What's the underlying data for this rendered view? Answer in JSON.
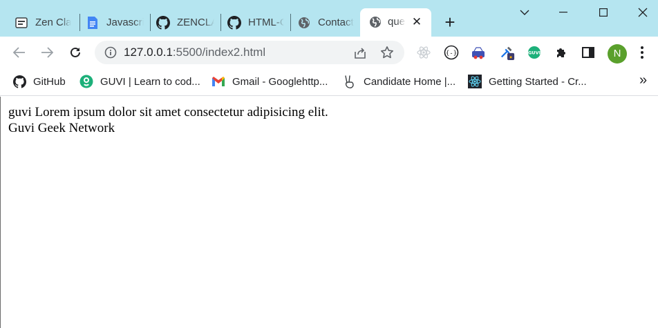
{
  "tabs": [
    {
      "title": "Zen Class",
      "icon": "zen-class-icon"
    },
    {
      "title": "Javascript",
      "icon": "google-docs-icon"
    },
    {
      "title": "ZENCLASS",
      "icon": "github-icon"
    },
    {
      "title": "HTML-CSS",
      "icon": "github-icon"
    },
    {
      "title": "Contact",
      "icon": "globe-icon"
    },
    {
      "title": "question",
      "icon": "globe-icon",
      "active": true
    }
  ],
  "address_bar": {
    "url_host": "127.0.0.1",
    "url_rest": ":5500/index2.html"
  },
  "profile": {
    "initial": "N"
  },
  "bookmarks": [
    {
      "label": "GitHub",
      "icon": "github-icon"
    },
    {
      "label": "GUVI | Learn to cod...",
      "icon": "guvi-icon"
    },
    {
      "label": "Gmail - Googlehttp...",
      "icon": "gmail-icon"
    },
    {
      "label": "Candidate Home |...",
      "icon": "victory-hand-icon"
    },
    {
      "label": "Getting Started - Cr...",
      "icon": "react-icon"
    }
  ],
  "bookmarks_more": "»",
  "page": {
    "line1": "guvi Lorem ipsum dolor sit amet consectetur adipisicing elit.",
    "line2": "Guvi Geek Network"
  },
  "colors": {
    "tabstrip": "#b5e5f0",
    "omnibox": "#f1f3f4",
    "avatar": "#5aa02c"
  }
}
